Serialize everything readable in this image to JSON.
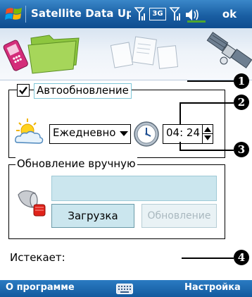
{
  "titlebar": {
    "title": "Satellite Data Upd",
    "network_badge": "3G",
    "ok_label": "ok"
  },
  "auto_update": {
    "label": "Автообновление",
    "checked": true,
    "frequency": "Ежедневно",
    "time": "04: 24"
  },
  "manual_update": {
    "legend": "Обновление вручную",
    "input_value": "",
    "download_label": "Загрузка",
    "refresh_label": "Обновление"
  },
  "expires_label": "Истекает:",
  "callouts": [
    "1",
    "2",
    "3",
    "4"
  ],
  "bottombar": {
    "left_label": "О программе",
    "right_label": "Настройка"
  },
  "colors": {
    "titlebar": "#1a5fa3",
    "button_fill": "#cbe6ee",
    "disabled_text": "#a9b8bf"
  }
}
